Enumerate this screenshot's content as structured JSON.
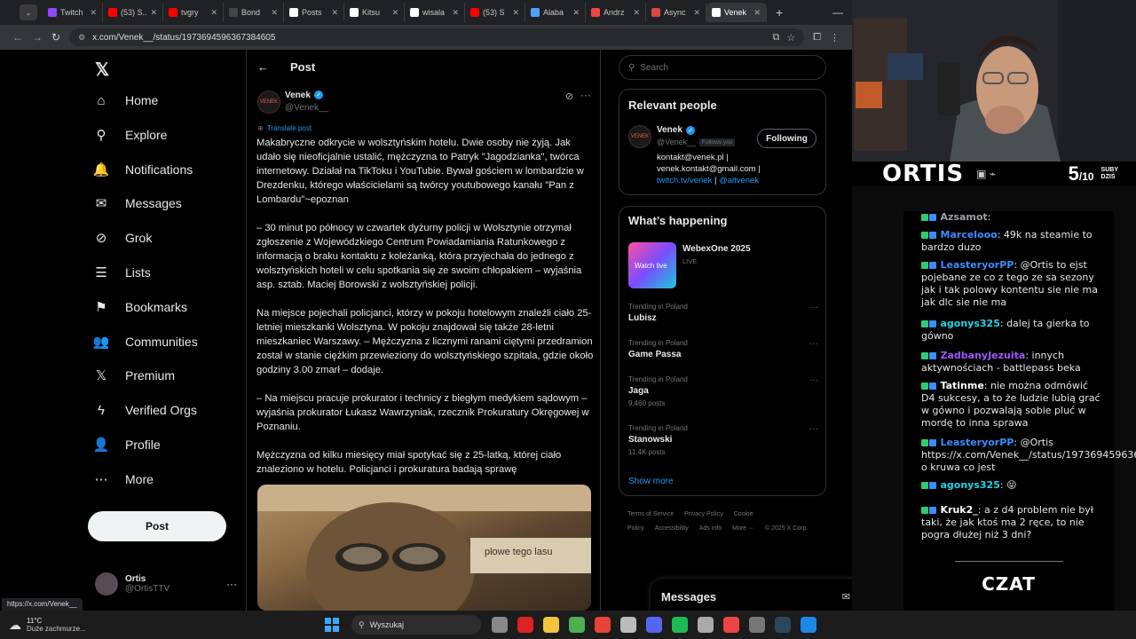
{
  "browser": {
    "tabs": [
      {
        "label": "Twitch",
        "color": "#9146ff"
      },
      {
        "label": "(53) S...",
        "color": "#ff0000"
      },
      {
        "label": "tvgry",
        "color": "#ff0000"
      },
      {
        "label": "Bond",
        "color": "#444444"
      },
      {
        "label": "Posts",
        "color": "#ffffff"
      },
      {
        "label": "Kitsu",
        "color": "#ffffff"
      },
      {
        "label": "wisala",
        "color": "#ffffff"
      },
      {
        "label": "(53) S",
        "color": "#ff0000"
      },
      {
        "label": "Alaba",
        "color": "#4ea1ff"
      },
      {
        "label": "Andrz",
        "color": "#e44"
      },
      {
        "label": "Async",
        "color": "#d44"
      },
      {
        "label": "Venek",
        "color": "#ffffff"
      }
    ],
    "url": "x.com/Venek__/status/1973694596367384605",
    "new_tab": "+"
  },
  "nav": {
    "items": [
      {
        "label": "Home",
        "icon": "home-icon",
        "glyph": "⌂"
      },
      {
        "label": "Explore",
        "icon": "search-icon",
        "glyph": "⚲"
      },
      {
        "label": "Notifications",
        "icon": "bell-icon",
        "glyph": "🔔"
      },
      {
        "label": "Messages",
        "icon": "mail-icon",
        "glyph": "✉"
      },
      {
        "label": "Grok",
        "icon": "grok-icon",
        "glyph": "⊘"
      },
      {
        "label": "Lists",
        "icon": "list-icon",
        "glyph": "☰"
      },
      {
        "label": "Bookmarks",
        "icon": "bookmark-icon",
        "glyph": "⚑"
      },
      {
        "label": "Communities",
        "icon": "communities-icon",
        "glyph": "👥"
      },
      {
        "label": "Premium",
        "icon": "x-logo-icon",
        "glyph": "𝕏"
      },
      {
        "label": "Verified Orgs",
        "icon": "lightning-icon",
        "glyph": "ϟ"
      },
      {
        "label": "Profile",
        "icon": "person-icon",
        "glyph": "👤"
      },
      {
        "label": "More",
        "icon": "more-circle-icon",
        "glyph": "⋯"
      }
    ],
    "post_button": "Post",
    "account": {
      "name": "Ortis",
      "handle": "@OrtisTTV",
      "menu": "···"
    }
  },
  "post": {
    "header_title": "Post",
    "author_name": "Venek",
    "author_handle": "@Venek__",
    "translate_label": "Translate post",
    "paragraphs": [
      "Makabryczne odkrycie w wolsztyńskim hotelu. Dwie osoby nie żyją. Jak udało się nieoficjalnie ustalić, mężczyzna to Patryk \"Jagodzianka\", twórca internetowy. Działał na TikToku i YouTubie. Bywał gościem w lombardzie w Drezdenku, którego właścicielami są twórcy youtubowego kanału \"Pan z Lombardu\"~epoznan",
      "– 30 minut po północy w czwartek dyżurny policji w Wolsztynie otrzymał zgłoszenie z Wojewódzkiego Centrum Powiadamiania Ratunkowego z informacją o braku kontaktu z koleżanką, która przyjechała do jednego z wolsztyńskich hoteli w celu spotkania się ze swoim chłopakiem – wyjaśnia asp. sztab. Maciej Borowski z wolsztyńskiej policji.",
      "Na miejsce pojechali policjanci, którzy w pokoju hotelowym znaleźli ciało 25-letniej mieszkanki Wolsztyna. W pokoju znajdował się także 28-letni mieszkaniec Warszawy. – Mężczyzna z licznymi ranami ciętymi przedramion został w stanie ciężkim przewieziony do wolsztyńskiego szpitala, gdzie około godziny 3.00 zmarł – dodaje.",
      "– Na miejscu pracuje prokurator i technicy z biegłym medykiem sądowym – wyjaśnia prokurator Łukasz Wawrzyniak, rzecznik Prokuratury Okręgowej w Poznaniu.",
      "Mężczyzna od kilku miesięcy miał spotykać się z 25-latką, której ciało znaleziono w hotelu. Policjanci i prokuratura badają sprawę"
    ],
    "image_text": "plowe tego lasu"
  },
  "right": {
    "search_placeholder": "Search",
    "relevant_title": "Relevant people",
    "person": {
      "name": "Venek",
      "handle": "@Venek__",
      "follows_you": "Follows you",
      "follow_button": "Following",
      "bio_1": "kontakt@venek.pl |",
      "bio_2": "venek.kontakt@gmail.com |",
      "bio_link_1": "twitch.tv/venek",
      "bio_sep": " | ",
      "bio_link_2": "@altvenek"
    },
    "happening_title": "What’s happening",
    "event": {
      "title": "WebexOne 2025",
      "status": "LIVE",
      "thumb_text": "Watch live"
    },
    "trends": [
      {
        "context": "Trending in Poland",
        "name": "Lubisz",
        "count": ""
      },
      {
        "context": "Trending in Poland",
        "name": "Game Passa",
        "count": ""
      },
      {
        "context": "Trending in Poland",
        "name": "Jaga",
        "count": "9,460 posts"
      },
      {
        "context": "Trending in Poland",
        "name": "Stanowski",
        "count": "11.4K posts"
      }
    ],
    "show_more": "Show more",
    "footer": [
      "Terms of Service",
      "Privacy Policy",
      "Cookie Policy",
      "Accessibility",
      "Ads info",
      "More ···",
      "© 2025 X Corp."
    ],
    "messages_label": "Messages"
  },
  "status_url": "https://x.com/Venek__",
  "stream": {
    "name": "ORTIS",
    "subs_count": "5",
    "subs_total": "/10",
    "subs_label_1": "SUBY",
    "subs_label_2": "DZIŚ",
    "chat_title": "CZAT",
    "chat": [
      {
        "user": "Azsamot",
        "color": "#9aa0a6",
        "text": ""
      },
      {
        "user": "Marcelooo",
        "color": "#3c8dff",
        "text": "49k na steamie to bardzo duzo"
      },
      {
        "user": "LeasteryorPP",
        "color": "#3c8dff",
        "text": "@Ortis to ejst pojebane ze co z tego ze sa sezony jak i tak polowy kontentu sie nie ma jak dlc sie nie ma"
      },
      {
        "user": "agonys325",
        "color": "#1ed6e6",
        "text": "dalej ta gierka to gówno"
      },
      {
        "user": "ZadbanyJezuita",
        "color": "#a056ff",
        "text": "innych aktywnościach - battlepass beka"
      },
      {
        "user": "Tatinme",
        "color": "#ffffff",
        "text": "nie można odmówić D4 sukcesy, a to że ludzie lubią grać w gówno i pozwalają sobie pluć w mordę to inna sprawa"
      },
      {
        "user": "LeasteryorPP",
        "color": "#3c8dff",
        "text": "@Ortis https://x.com/Venek__/status/1973694596367384605 o kruwa co jest"
      },
      {
        "user": "agonys325",
        "color": "#1ed6e6",
        "text": "😝"
      },
      {
        "user": "Kruk2_",
        "color": "#ffffff",
        "text": "a z d4 problem nie był taki, że jak ktoś ma 2 ręce, to nie pogra dłużej niż 3 dni?"
      }
    ]
  },
  "taskbar": {
    "weather_temp": "11°C",
    "weather_desc": "Duże zachmurze...",
    "search_placeholder": "Wyszukaj"
  }
}
